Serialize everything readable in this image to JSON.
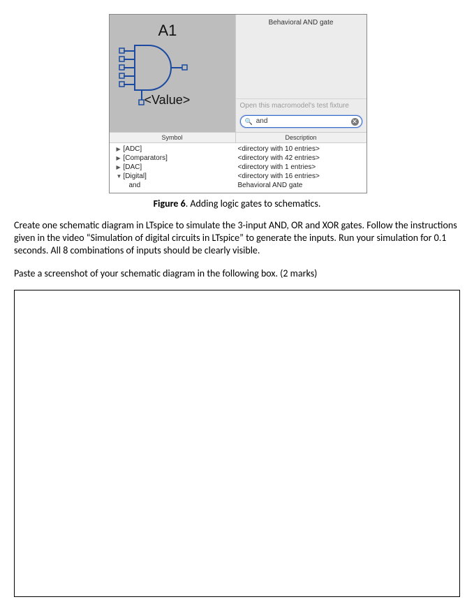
{
  "figure": {
    "label": "Figure 6",
    "caption": ". Adding logic gates to schematics."
  },
  "app": {
    "info_title": "Behavioral AND gate",
    "open_fixture": "Open this macromodel's test fixture",
    "search_value": "and",
    "headers": {
      "symbol": "Symbol",
      "description": "Description"
    },
    "gate": {
      "ref": "A1",
      "value": "<Value>"
    },
    "tree": [
      {
        "arrow": "▶",
        "label": "[ADC]",
        "desc": "<directory with   10 entries>",
        "child": false
      },
      {
        "arrow": "▶",
        "label": "[Comparators]",
        "desc": "<directory with   42 entries>",
        "child": false
      },
      {
        "arrow": "▶",
        "label": "[DAC]",
        "desc": "<directory with    1 entries>",
        "child": false
      },
      {
        "arrow": "▼",
        "label": "[Digital]",
        "desc": "<directory with   16 entries>",
        "child": false
      },
      {
        "arrow": "",
        "label": "and",
        "desc": "Behavioral AND gate",
        "child": true
      }
    ]
  },
  "body": {
    "p1": "Create one schematic diagram in LTspice to simulate the 3-input AND, OR and XOR gates. Follow the instructions given in the video “Simulation of digital circuits in LTspice” to generate the inputs. Run your simulation for 0.1 seconds. All 8 combinations of inputs should be clearly visible.",
    "p2": "Paste a screenshot of your schematic diagram in the following box. (2 marks)"
  }
}
